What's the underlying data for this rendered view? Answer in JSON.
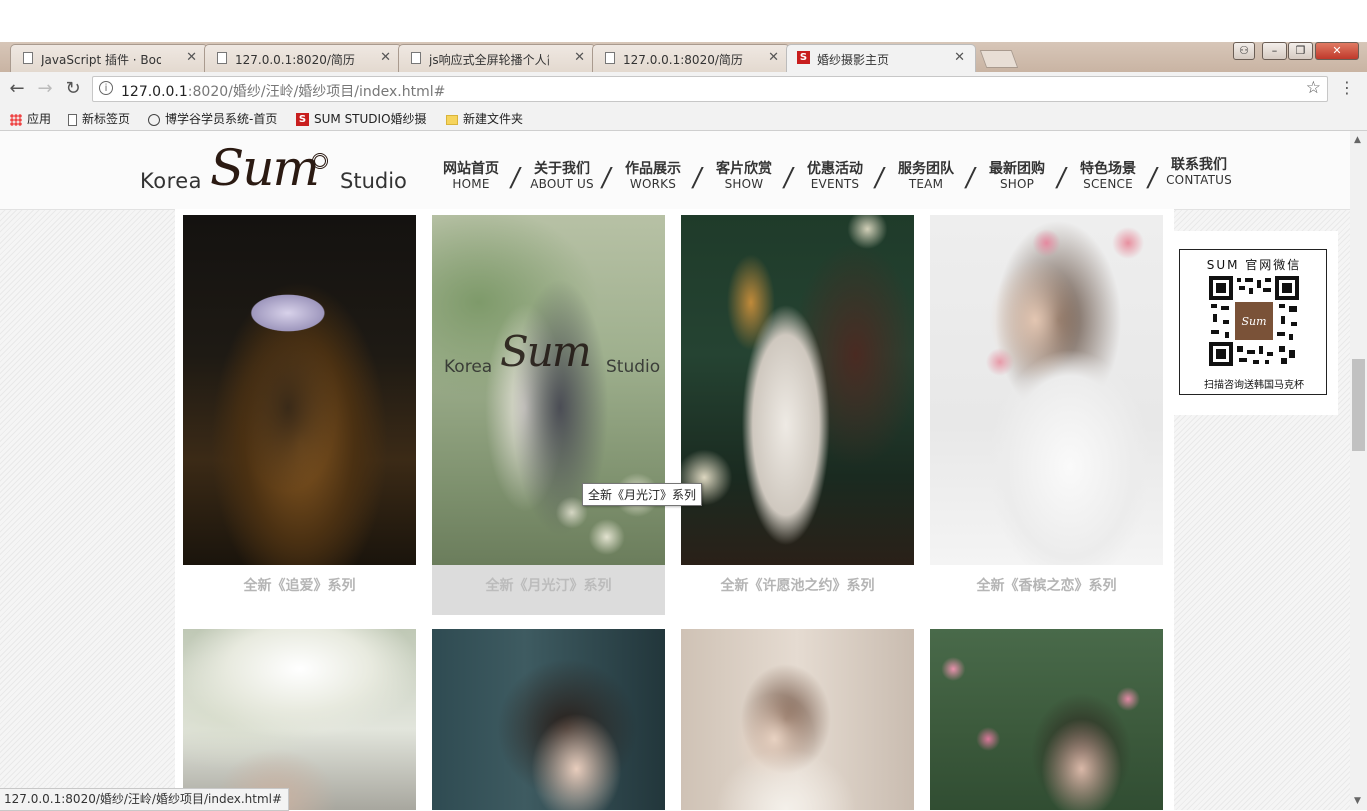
{
  "browser": {
    "tabs": [
      {
        "label": "JavaScript 插件 · Bootst",
        "icon": "page-icon"
      },
      {
        "label": "127.0.0.1:8020/简历/简",
        "icon": "page-icon"
      },
      {
        "label": "js响应式全屏轮播个人简",
        "icon": "page-icon"
      },
      {
        "label": "127.0.0.1:8020/简历/简",
        "icon": "page-icon"
      },
      {
        "label": "婚纱摄影主页",
        "icon": "sum-favicon",
        "active": true
      }
    ],
    "url_host": "127.0.0.1",
    "url_rest": ":8020/婚纱/汪岭/婚纱项目/index.html#",
    "bookmarks": [
      {
        "label": "应用",
        "icon": "apps-icon"
      },
      {
        "label": "新标签页",
        "icon": "page-icon"
      },
      {
        "label": "博学谷学员系统-首页",
        "icon": "globe-icon"
      },
      {
        "label": "SUM STUDIO婚纱摄",
        "icon": "sum-favicon"
      },
      {
        "label": "新建文件夹",
        "icon": "folder-icon"
      }
    ],
    "status_text": "127.0.0.1:8020/婚纱/汪岭/婚纱项目/index.html#"
  },
  "site": {
    "logo": {
      "korea": "Korea",
      "sum": "Sum",
      "studio": "Studio"
    },
    "nav": [
      {
        "cn": "网站首页",
        "en": "HOME"
      },
      {
        "cn": "关于我们",
        "en": "ABOUT US"
      },
      {
        "cn": "作品展示",
        "en": "WORKS"
      },
      {
        "cn": "客片欣赏",
        "en": "SHOW"
      },
      {
        "cn": "优惠活动",
        "en": "EVENTS"
      },
      {
        "cn": "服务团队",
        "en": "TEAM"
      },
      {
        "cn": "最新团购",
        "en": "SHOP"
      },
      {
        "cn": "特色场景",
        "en": "SCENCE"
      },
      {
        "cn": "联系我们",
        "en": "CONTATUS"
      }
    ],
    "gallery": [
      {
        "caption": "全新《追爱》系列"
      },
      {
        "caption": "全新《月光汀》系列"
      },
      {
        "caption": "全新《许愿池之约》系列"
      },
      {
        "caption": "全新《香槟之恋》系列"
      }
    ],
    "tooltip": "全新《月光汀》系列",
    "qr": {
      "title": "SUM 官网微信",
      "caption": "扫描咨询送韩国马克杯",
      "center_mark": "Sum"
    }
  }
}
